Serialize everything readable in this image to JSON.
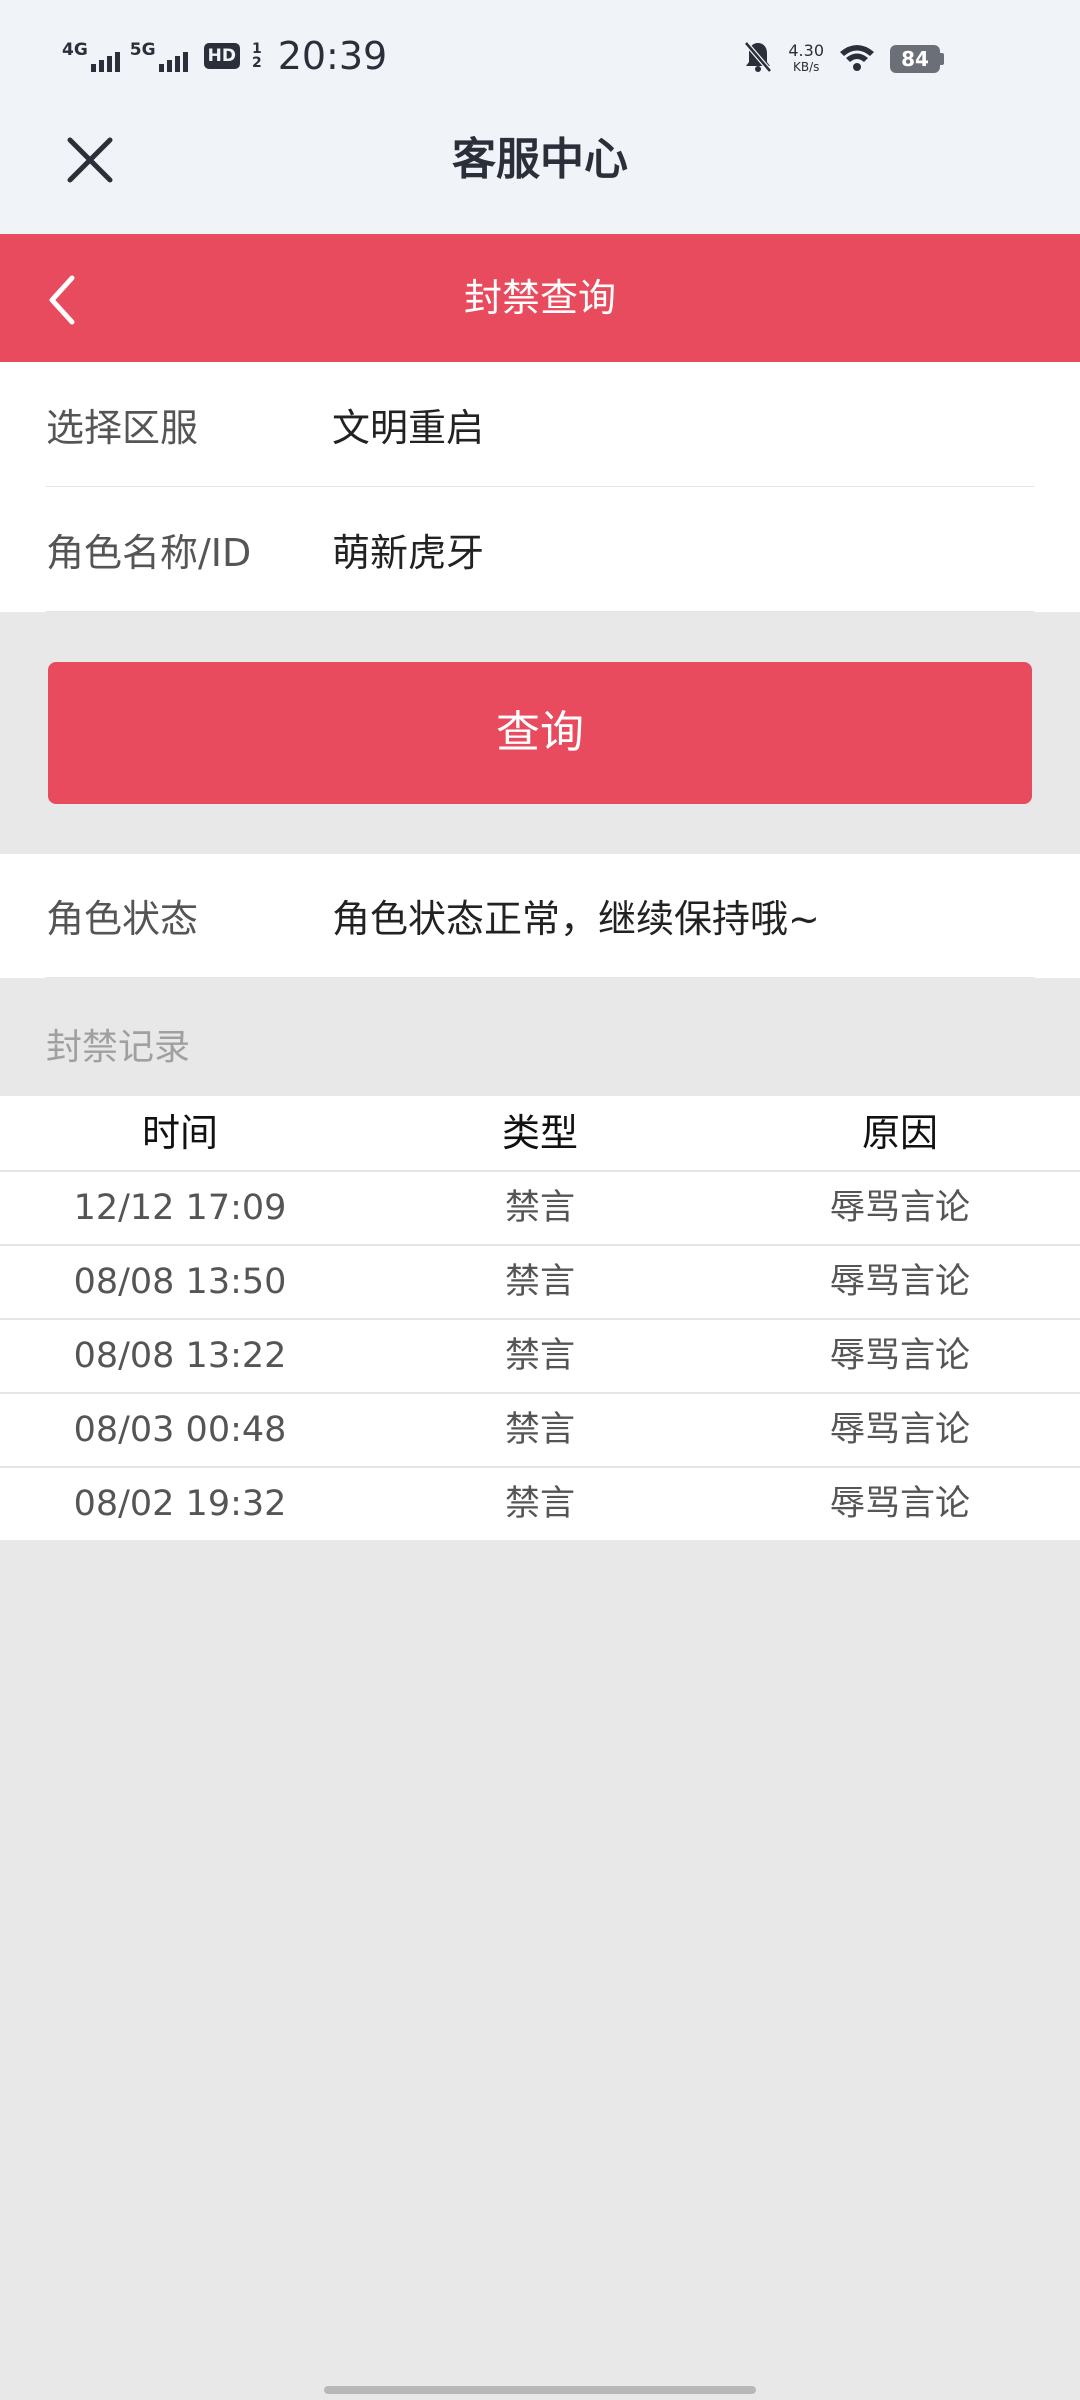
{
  "status_bar": {
    "net1": "4G",
    "net2": "5G",
    "hd": "HD",
    "hd_sup": "1",
    "hd_sub": "2",
    "time": "20:39",
    "speed_value": "4.30",
    "speed_unit": "KB/s",
    "battery": "84"
  },
  "header": {
    "title": "客服中心",
    "close_icon": "close-icon"
  },
  "subheader": {
    "title": "封禁查询",
    "back_icon": "chevron-left-icon",
    "color": "#e84b5d"
  },
  "form": {
    "server_label": "选择区服",
    "server_value": "文明重启",
    "role_label": "角色名称/ID",
    "role_value": "萌新虎牙"
  },
  "query_button": {
    "label": "查询"
  },
  "role_status": {
    "label": "角色状态",
    "value": "角色状态正常，继续保持哦~"
  },
  "records": {
    "title": "封禁记录",
    "columns": [
      "时间",
      "类型",
      "原因"
    ],
    "rows": [
      [
        "12/12 17:09",
        "禁言",
        "辱骂言论"
      ],
      [
        "08/08 13:50",
        "禁言",
        "辱骂言论"
      ],
      [
        "08/08 13:22",
        "禁言",
        "辱骂言论"
      ],
      [
        "08/03 00:48",
        "禁言",
        "辱骂言论"
      ],
      [
        "08/02 19:32",
        "禁言",
        "辱骂言论"
      ]
    ]
  }
}
